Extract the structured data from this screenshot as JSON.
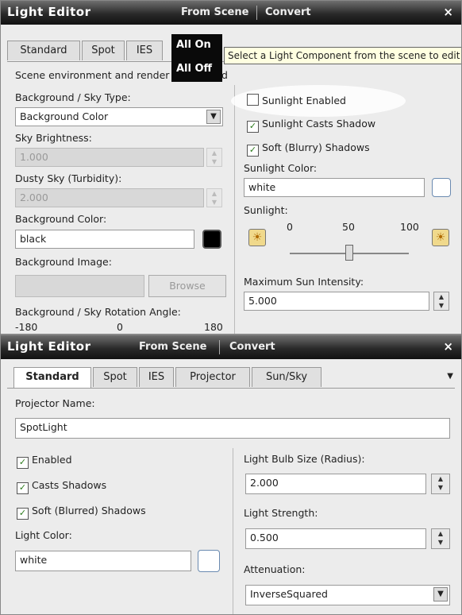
{
  "panel1": {
    "title": "Light Editor",
    "menu_from_scene": "From Scene",
    "menu_convert": "Convert",
    "close": "×",
    "dropdown": [
      "All On",
      "All Off"
    ],
    "tooltip": "Select a Light Component from the scene to edit",
    "tabs": [
      "Standard",
      "Spot",
      "IES"
    ],
    "intro_left": "Scene environment and render",
    "intro_right": "d",
    "bg_sky_type_label": "Background / Sky Type:",
    "bg_sky_type_value": "Background Color",
    "sky_brightness_label": "Sky Brightness:",
    "sky_brightness_value": "1.000",
    "dusty_sky_label": "Dusty Sky (Turbidity):",
    "dusty_sky_value": "2.000",
    "bg_color_label": "Background Color:",
    "bg_color_value": "black",
    "bg_color_swatch": "#000000",
    "bg_image_label": "Background Image:",
    "browse": "Browse",
    "rotation_label": "Background / Sky Rotation Angle:",
    "rotation_ticks": [
      "-180",
      "0",
      "180"
    ],
    "sunlight_enabled": "Sunlight Enabled",
    "sunlight_casts_shadow": "Sunlight Casts Shadow",
    "soft_shadows": "Soft (Blurry) Shadows",
    "sunlight_color_label": "Sunlight Color:",
    "sunlight_color_value": "white",
    "sunlight_label": "Sunlight:",
    "sunlight_ticks": [
      "0",
      "50",
      "100"
    ],
    "sunlight_slider_level": 0.5,
    "max_sun_label": "Maximum Sun Intensity:",
    "max_sun_value": "5.000"
  },
  "panel2": {
    "title": "Light Editor",
    "menu_from_scene": "From Scene",
    "menu_convert": "Convert",
    "close": "×",
    "tabs": [
      "Standard",
      "Spot",
      "IES",
      "Projector",
      "Sun/Sky"
    ],
    "tab_menu_arrow": "▼",
    "projector_name_label": "Projector Name:",
    "projector_name_value": "SpotLight",
    "enabled": "Enabled",
    "casts_shadows": "Casts Shadows",
    "soft_shadows": "Soft (Blurred) Shadows",
    "light_color_label": "Light Color:",
    "light_color_value": "white",
    "bulb_size_label": "Light Bulb Size (Radius):",
    "bulb_size_value": "2.000",
    "strength_label": "Light Strength:",
    "strength_value": "0.500",
    "attenuation_label": "Attenuation:",
    "attenuation_value": "InverseSquared"
  },
  "colors": {
    "title_bar": "#1a1a1a",
    "check_green": "#2a7a1a",
    "swatch_black": "#000000"
  },
  "icons": [
    "sun-icon",
    "check-icon",
    "spin-up-icon",
    "spin-down-icon",
    "chevron-down-icon",
    "close-icon"
  ]
}
